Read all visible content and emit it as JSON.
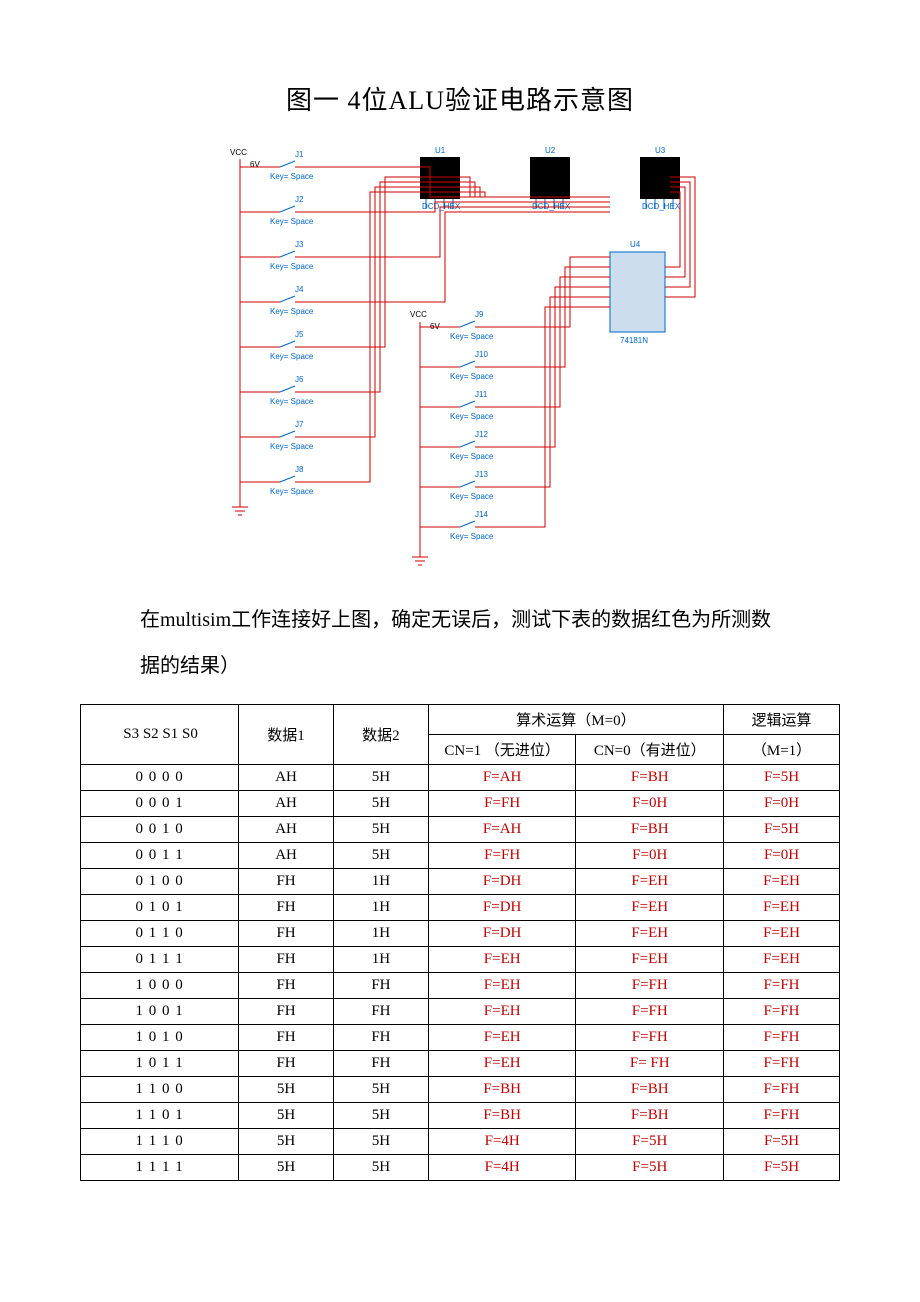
{
  "title": "图一 4位ALU验证电路示意图",
  "circuit": {
    "vcc_label": "VCC",
    "vcc_voltage": "6V",
    "switch_key_label": "Key= Space",
    "left_switches": [
      "J1",
      "J2",
      "J3",
      "J4",
      "J5",
      "J6",
      "J7",
      "J8"
    ],
    "right_switches": [
      "J9",
      "J10",
      "J11",
      "J12",
      "J13",
      "J14"
    ],
    "displays": [
      {
        "ref": "U1",
        "type": "DCD_HEX"
      },
      {
        "ref": "U2",
        "type": "DCD_HEX"
      },
      {
        "ref": "U3",
        "type": "DCD_HEX"
      }
    ],
    "alu_ref": "U4",
    "alu_part": "74181N"
  },
  "body_text": "在multisim工作连接好上图，确定无误后，测试下表的数据红色为所测数据的结果）",
  "table": {
    "headers": {
      "s_cols": "S3 S2 S1 S0",
      "data1": "数据1",
      "data2": "数据2",
      "arith_group": "算术运算（M=0）",
      "arith_cn1": "CN=1 （无进位）",
      "arith_cn0": "CN=0（有进位）",
      "logic_group": "逻辑运算",
      "logic_m1": "（M=1）"
    },
    "rows": [
      {
        "s": "0 0 0 0",
        "d1": "AH",
        "d2": "5H",
        "a1": "F=AH",
        "a0": "F=BH",
        "l": "F=5H"
      },
      {
        "s": "0 0 0 1",
        "d1": "AH",
        "d2": "5H",
        "a1": "F=FH",
        "a0": "F=0H",
        "l": "F=0H"
      },
      {
        "s": "0 0 1 0",
        "d1": "AH",
        "d2": "5H",
        "a1": "F=AH",
        "a0": "F=BH",
        "l": "F=5H"
      },
      {
        "s": "0 0 1 1",
        "d1": "AH",
        "d2": "5H",
        "a1": "F=FH",
        "a0": "F=0H",
        "l": "F=0H"
      },
      {
        "s": "0 1 0 0",
        "d1": "FH",
        "d2": "1H",
        "a1": "F=DH",
        "a0": "F=EH",
        "l": "F=EH"
      },
      {
        "s": "0 1 0 1",
        "d1": "FH",
        "d2": "1H",
        "a1": "F=DH",
        "a0": "F=EH",
        "l": "F=EH"
      },
      {
        "s": "0 1 1 0",
        "d1": "FH",
        "d2": "1H",
        "a1": "F=DH",
        "a0": "F=EH",
        "l": "F=EH"
      },
      {
        "s": "0 1 1 1",
        "d1": "FH",
        "d2": "1H",
        "a1": "F=EH",
        "a0": "F=EH",
        "l": "F=EH"
      },
      {
        "s": "1 0 0 0",
        "d1": "FH",
        "d2": "FH",
        "a1": "F=EH",
        "a0": "F=FH",
        "l": "F=FH"
      },
      {
        "s": "1 0 0 1",
        "d1": "FH",
        "d2": "FH",
        "a1": "F=EH",
        "a0": "F=FH",
        "l": "F=FH"
      },
      {
        "s": "1 0 1 0",
        "d1": "FH",
        "d2": "FH",
        "a1": "F=EH",
        "a0": "F=FH",
        "l": "F=FH"
      },
      {
        "s": "1 0 1 1",
        "d1": "FH",
        "d2": "FH",
        "a1": "F=EH",
        "a0": "F= FH",
        "l": "F=FH"
      },
      {
        "s": "1 1 0 0",
        "d1": "5H",
        "d2": "5H",
        "a1": "F=BH",
        "a0": "F=BH",
        "l": "F=FH"
      },
      {
        "s": "1 1 0 1",
        "d1": "5H",
        "d2": "5H",
        "a1": "F=BH",
        "a0": "F=BH",
        "l": "F=FH"
      },
      {
        "s": "1 1 1 0",
        "d1": "5H",
        "d2": "5H",
        "a1": "F=4H",
        "a0": "F=5H",
        "l": "F=5H"
      },
      {
        "s": "1 1 1 1",
        "d1": "5H",
        "d2": "5H",
        "a1": "F=4H",
        "a0": "F=5H",
        "l": "F=5H"
      }
    ]
  }
}
